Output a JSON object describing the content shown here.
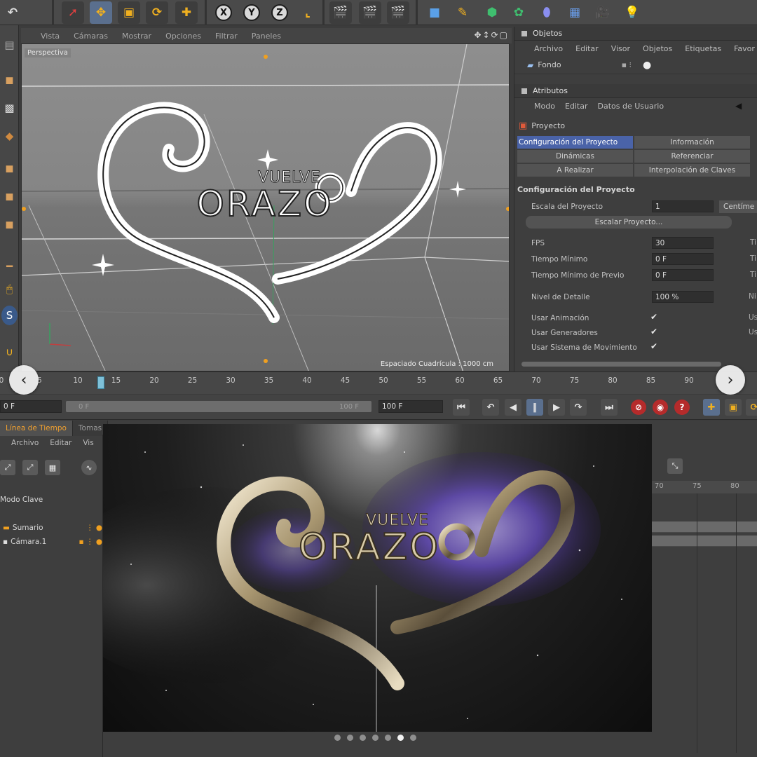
{
  "toolbar": {
    "undo": "↶",
    "axes": [
      "X",
      "Y",
      "Z"
    ]
  },
  "viewport": {
    "menu": [
      "Vista",
      "Cámaras",
      "Mostrar",
      "Opciones",
      "Filtrar",
      "Paneles"
    ],
    "label": "Perspectiva",
    "grid_spacing": "Espaciado Cuadrícula : 1000 cm",
    "logo_text_top": "VUELVE",
    "logo_text_main": "ORAZO"
  },
  "objects_panel": {
    "title": "Objetos",
    "menu": [
      "Archivo",
      "Editar",
      "Visor",
      "Objetos",
      "Etiquetas",
      "Favor"
    ],
    "item": "Fondo"
  },
  "attributes_panel": {
    "title": "Atributos",
    "menu": [
      "Modo",
      "Editar",
      "Datos de Usuario"
    ],
    "object": "Proyecto",
    "tabs": [
      "Configuración del Proyecto",
      "Información",
      "Dinámicas",
      "Referenciar",
      "A Realizar",
      "Interpolación de Claves"
    ],
    "section": "Configuración del Proyecto",
    "scale_label": "Escala del Proyecto",
    "scale_value": "1",
    "scale_unit": "Centíme",
    "scale_button": "Escalar Proyecto...",
    "fps_label": "FPS",
    "fps_value": "30",
    "min_time_label": "Tiempo Mínimo",
    "min_time_value": "0 F",
    "min_preview_label": "Tiempo Mínimo de Previo",
    "min_preview_value": "0 F",
    "detail_label": "Nivel de Detalle",
    "detail_value": "100 %",
    "use_anim": "Usar Animación",
    "use_gen": "Usar Generadores",
    "use_motion": "Usar Sistema de Movimiento",
    "clip_right": [
      "Ti",
      "Ti",
      "Ti",
      "Ni",
      "Us",
      "Us"
    ]
  },
  "ruler": {
    "labels": [
      "0",
      "5",
      "10",
      "15",
      "20",
      "25",
      "30",
      "35",
      "40",
      "45",
      "50",
      "55",
      "60",
      "65",
      "70",
      "75",
      "80",
      "85",
      "90"
    ]
  },
  "transport": {
    "current_frame": "0 F",
    "slider_start": "0 F",
    "slider_end": "100 F",
    "end_frame": "100 F"
  },
  "timeline": {
    "tabs": [
      "Línea de Tiempo",
      "Tomas"
    ],
    "menu": [
      "Archivo",
      "Editar",
      "Vis"
    ],
    "mode": "Modo Clave",
    "tracks": [
      "Sumario",
      "Cámara.1"
    ],
    "ruler_right": [
      "70",
      "75",
      "80"
    ]
  },
  "render": {
    "logo_text_top": "VUELVE",
    "logo_text_main": "ORAZO"
  },
  "pager": {
    "count": 7,
    "active": 5
  }
}
